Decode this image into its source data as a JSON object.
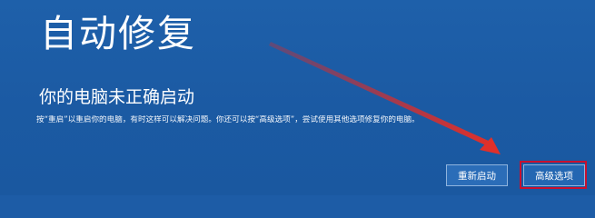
{
  "screen": {
    "background_color": "#1d5ca6",
    "title": "自动修复",
    "subtitle": "你的电脑未正确启动",
    "description": "按“重启”以重启你的电脑，有时这样可以解决问题。你还可以按“高级选项”，尝试使用其他选项修复你的电脑。"
  },
  "buttons": {
    "restart_label": "重新启动",
    "advanced_label": "高级选项"
  },
  "annotation": {
    "arrow_color": "#d42a2a",
    "highlight_color": "#c8102e"
  }
}
